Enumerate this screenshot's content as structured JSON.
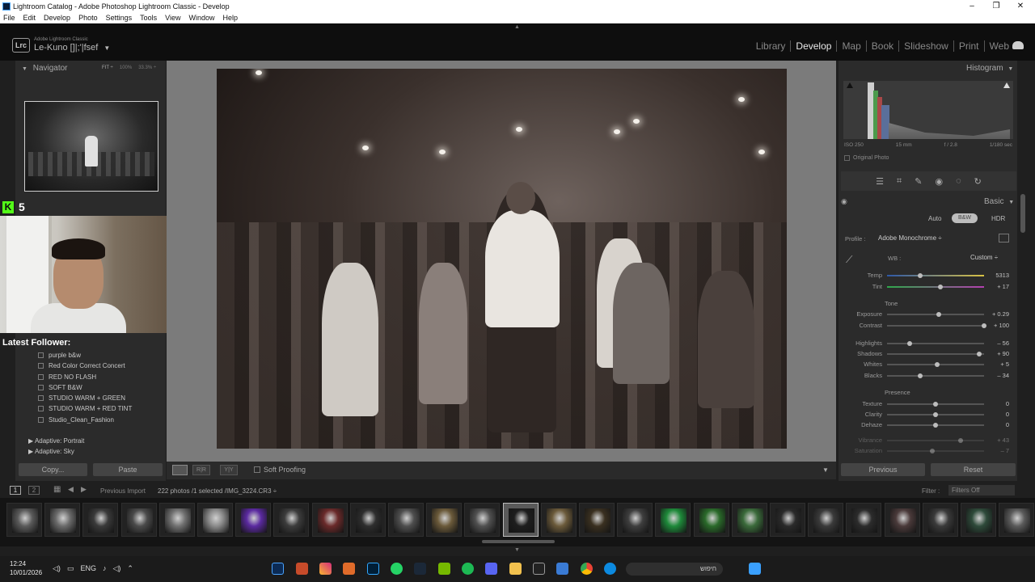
{
  "window": {
    "title": "Lightroom Catalog - Adobe Photoshop Lightroom Classic - Develop",
    "menu": [
      "File",
      "Edit",
      "Develop",
      "Photo",
      "Settings",
      "Tools",
      "View",
      "Window",
      "Help"
    ]
  },
  "identity": {
    "badge": "Lrc",
    "product": "Adobe Lightroom Classic",
    "catalog": "Le-Kuno []|;'|fsef"
  },
  "modules": [
    "Library",
    "Develop",
    "Map",
    "Book",
    "Slideshow",
    "Print",
    "Web"
  ],
  "active_module": "Develop",
  "navigator": {
    "title": "Navigator",
    "zoom_fit": "FIT ÷",
    "zoom_100": "100%",
    "zoom_other": "33.3% ÷"
  },
  "overlay": {
    "kick_letter": "K",
    "kick_count": "5",
    "latest_follower_label": "Latest Follower:"
  },
  "presets": [
    "purple b&w",
    "Red Color Correct Concert",
    "RED NO FLASH",
    "SOFT B&W",
    "STUDIO WARM + GREEN",
    "STUDIO WARM + RED TINT",
    "Studio_Clean_Fashion"
  ],
  "preset_folders": [
    "Adaptive: Portrait",
    "Adaptive: Sky"
  ],
  "left_buttons": {
    "copy": "Copy...",
    "paste": "Paste"
  },
  "toolbar": {
    "soft_proofing": "Soft Proofing"
  },
  "histogram": {
    "title": "Histogram",
    "iso": "ISO 250",
    "focal": "15 mm",
    "aperture": "f / 2.8",
    "shutter": "1/180 sec",
    "original_photo": "Original Photo"
  },
  "basic": {
    "title": "Basic",
    "mode_auto": "Auto",
    "mode_bw": "B&W",
    "mode_hdr": "HDR",
    "profile_label": "Profile :",
    "profile_value": "Adobe Monochrome ÷",
    "wb_label": "WB :",
    "wb_value": "Custom ÷",
    "tone_label": "Tone",
    "presence_label": "Presence",
    "sliders": [
      {
        "label": "Temp",
        "value": "5313",
        "pos": 0.34
      },
      {
        "label": "Tint",
        "value": "+ 17",
        "pos": 0.55
      },
      {
        "label": "Exposure",
        "value": "+ 0.29",
        "pos": 0.53
      },
      {
        "label": "Contrast",
        "value": "+ 100",
        "pos": 1.0
      },
      {
        "label": "Highlights",
        "value": "– 56",
        "pos": 0.23
      },
      {
        "label": "Shadows",
        "value": "+ 90",
        "pos": 0.95
      },
      {
        "label": "Whites",
        "value": "+ 5",
        "pos": 0.52
      },
      {
        "label": "Blacks",
        "value": "– 34",
        "pos": 0.34
      },
      {
        "label": "Texture",
        "value": "0",
        "pos": 0.5
      },
      {
        "label": "Clarity",
        "value": "0",
        "pos": 0.5
      },
      {
        "label": "Dehaze",
        "value": "0",
        "pos": 0.5
      },
      {
        "label": "Vibrance",
        "value": "+ 43",
        "pos": 0.76
      },
      {
        "label": "Saturation",
        "value": "– 7",
        "pos": 0.47
      }
    ]
  },
  "right_buttons": {
    "previous": "Previous",
    "reset": "Reset"
  },
  "filmstrip": {
    "screen1": "1",
    "screen2": "2",
    "source": "Previous Import",
    "count": "222 photos /1 selected /IMG_3224.CR3 ÷",
    "filter_label": "Filter :",
    "filter_value": "Filters Off"
  },
  "taskbar": {
    "time": "12:24",
    "date": "10/01/2026",
    "lang": "ENG",
    "search": "חיפוש"
  }
}
